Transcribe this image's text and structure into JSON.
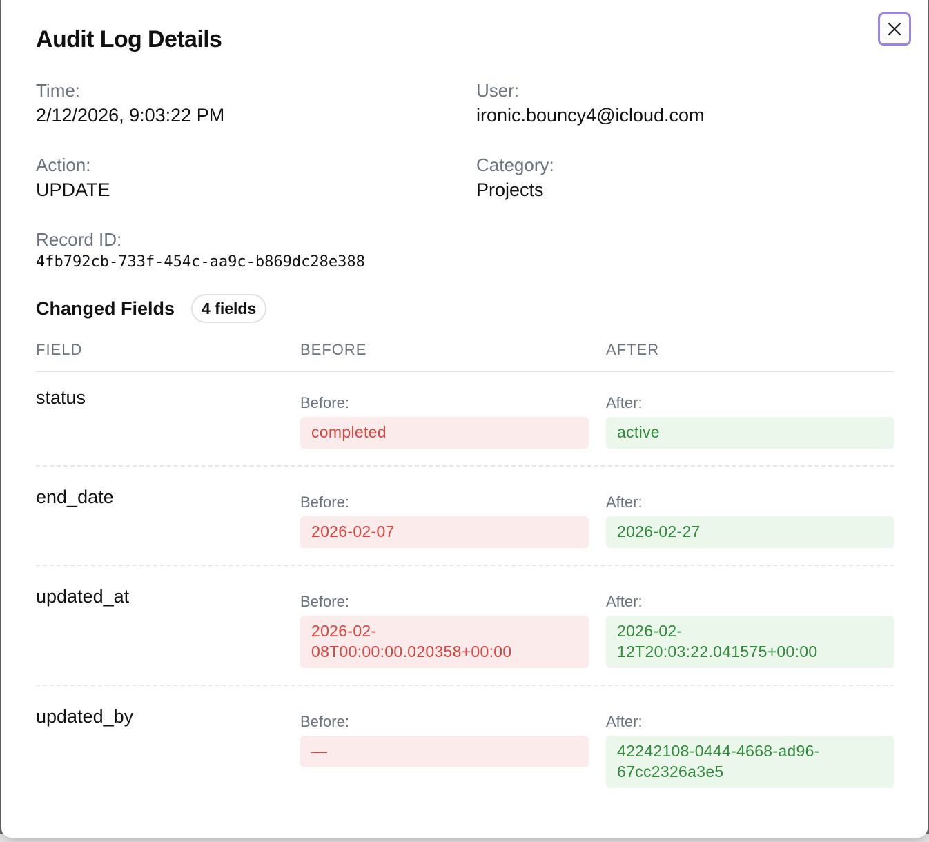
{
  "modal": {
    "title": "Audit Log Details",
    "close_icon": "close-icon"
  },
  "meta": {
    "time_label": "Time:",
    "time_value": "2/12/2026, 9:03:22 PM",
    "user_label": "User:",
    "user_value": "ironic.bouncy4@icloud.com",
    "action_label": "Action:",
    "action_value": "UPDATE",
    "category_label": "Category:",
    "category_value": "Projects",
    "record_label": "Record ID:",
    "record_value": "4fb792cb-733f-454c-aa9c-b869dc28e388"
  },
  "changes": {
    "title": "Changed Fields",
    "count_badge": "4 fields",
    "headers": {
      "field": "FIELD",
      "before": "BEFORE",
      "after": "AFTER"
    },
    "before_label": "Before:",
    "after_label": "After:",
    "rows": [
      {
        "field": "status",
        "before": "completed",
        "after": "active"
      },
      {
        "field": "end_date",
        "before": "2026-02-07",
        "after": "2026-02-27"
      },
      {
        "field": "updated_at",
        "before": "2026-02-\n08T00:00:00.020358+00:00",
        "after": "2026-02-\n12T20:03:22.041575+00:00"
      },
      {
        "field": "updated_by",
        "before": "—",
        "after": "42242108-0444-4668-ad96-\n67cc2326a3e5"
      }
    ]
  },
  "colors": {
    "before_bg": "#fcebeb",
    "before_text": "#d9443f",
    "after_bg": "#ecf7ec",
    "after_text": "#2f8a3a",
    "focus_ring": "#9b82e8"
  }
}
